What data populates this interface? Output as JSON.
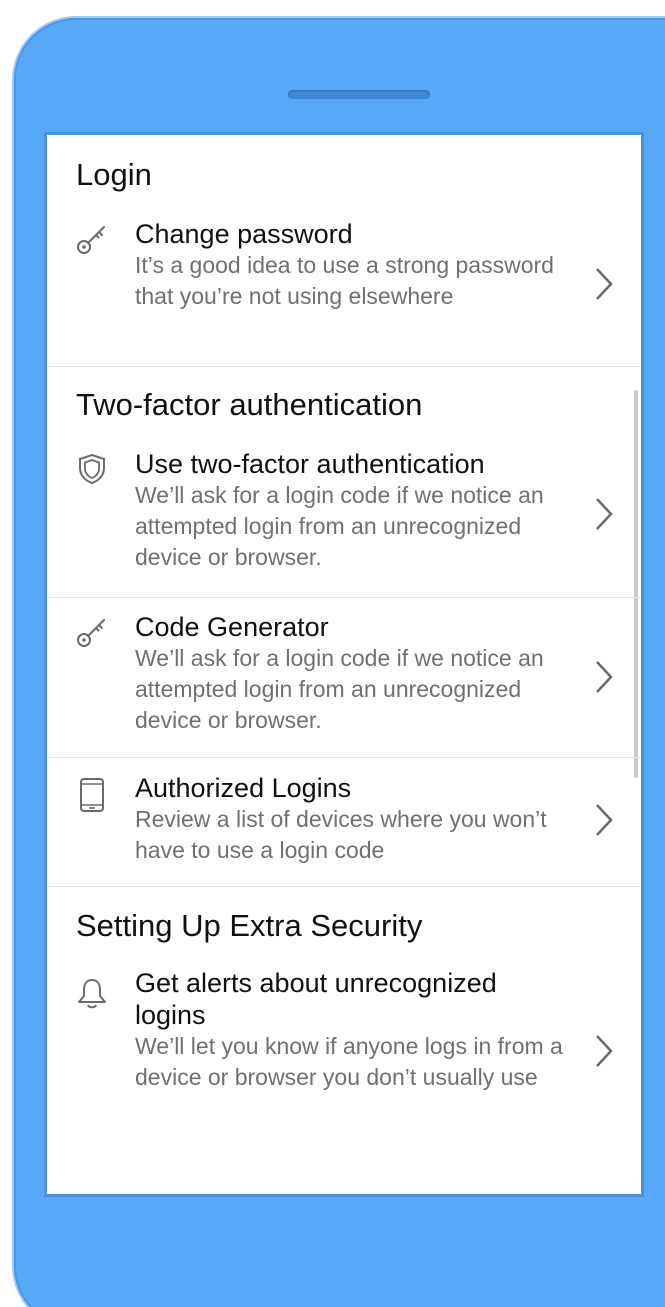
{
  "sections": [
    {
      "title": "Login",
      "items": [
        {
          "title": "Change password",
          "description": "It’s a good idea to use a strong password that you’re not using elsewhere",
          "icon": "key-icon"
        }
      ]
    },
    {
      "title": "Two-factor authentication",
      "items": [
        {
          "title": "Use two-factor authentication",
          "description": "We’ll ask for a login code if we notice an attempted login from an unrecognized device or browser.",
          "icon": "shield-icon"
        },
        {
          "title": "Code Generator",
          "description": "We’ll ask for a login code if we notice an attempted login from an unrecognized device or browser.",
          "icon": "key-icon"
        },
        {
          "title": "Authorized Logins",
          "description": "Review a list of devices where you won’t have to use a login code",
          "icon": "phone-icon"
        }
      ]
    },
    {
      "title": "Setting Up Extra Security",
      "items": [
        {
          "title": "Get alerts about unrecognized logins",
          "description": "We’ll let you know if anyone logs in from a device or browser you don’t usually use",
          "icon": "bell-icon"
        }
      ]
    }
  ],
  "colors": {
    "phone_body": "#57a8f7",
    "screen_border": "#4a92de",
    "text_primary": "#111111",
    "text_secondary": "#707070",
    "icon": "#6a6a6a",
    "divider": "#e3e3e3"
  }
}
